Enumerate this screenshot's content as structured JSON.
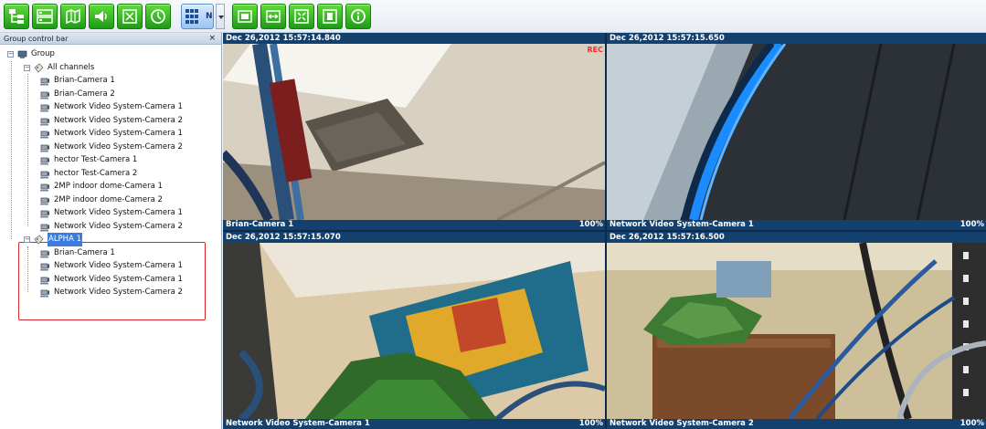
{
  "toolbar": {
    "buttons": [
      {
        "icon": "group-tree-icon"
      },
      {
        "icon": "device-list-icon"
      },
      {
        "icon": "map-icon"
      },
      {
        "icon": "audio-icon"
      },
      {
        "icon": "fullscreen-icon"
      },
      {
        "icon": "playback-icon"
      },
      {
        "icon": "layout-icon",
        "label": "N"
      },
      {
        "icon": "single-view-icon"
      },
      {
        "icon": "stretch-icon"
      },
      {
        "icon": "expand-icon"
      },
      {
        "icon": "fit-icon"
      },
      {
        "icon": "info-icon"
      }
    ]
  },
  "panel": {
    "title": "Group control bar",
    "close": "×",
    "root": "Group",
    "groups": [
      {
        "name": "All channels",
        "channels": [
          "Brian-Camera 1",
          "Brian-Camera 2",
          "Network Video System-Camera 1",
          "Network Video System-Camera 2",
          "Network Video System-Camera 1",
          "Network Video System-Camera 2",
          "hector Test-Camera 1",
          "hector Test-Camera 2",
          "2MP indoor dome-Camera 1",
          "2MP indoor dome-Camera 2",
          "Network Video System-Camera 1",
          "Network Video System-Camera 2"
        ]
      },
      {
        "name": "ALPHA 1",
        "selected": true,
        "channels": [
          "Brian-Camera 1",
          "Network Video System-Camera 1",
          "Network Video System-Camera 1",
          "Network Video System-Camera 2"
        ]
      }
    ]
  },
  "views": [
    {
      "timestamp": "Dec 26,2012 15:57:14.840",
      "camera": "Brian-Camera 1",
      "zoom": "100%",
      "rec": "REC"
    },
    {
      "timestamp": "Dec 26,2012 15:57:15.650",
      "camera": "Network Video System-Camera 1",
      "zoom": "100%"
    },
    {
      "timestamp": "Dec 26,2012 15:57:15.070",
      "camera": "Network Video System-Camera 1",
      "zoom": "100%"
    },
    {
      "timestamp": "Dec 26,2012 15:57:16.500",
      "camera": "Network Video System-Camera 2",
      "zoom": "100%"
    }
  ],
  "colors": {
    "accent_green": "#2bb51f",
    "label_bar": "#14406e",
    "rec": "#ff2a2a",
    "highlight": "#d9262b",
    "selection": "#3b7ddd"
  }
}
